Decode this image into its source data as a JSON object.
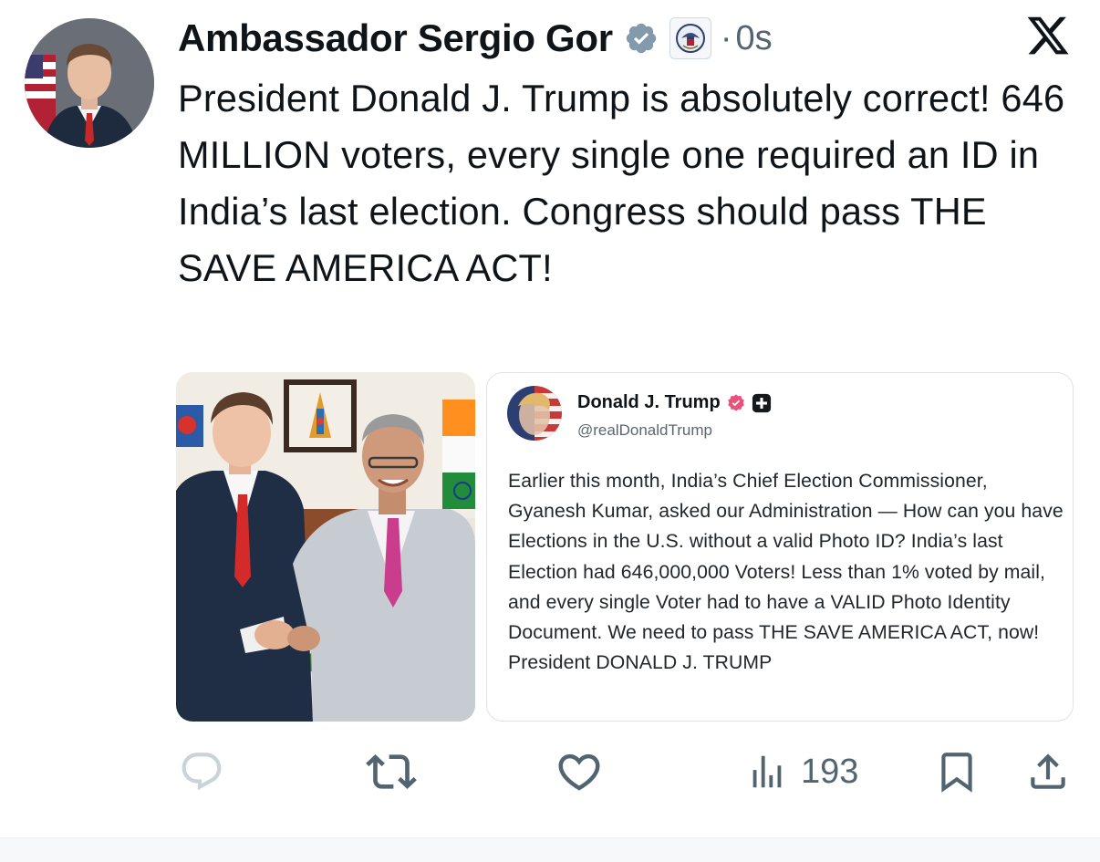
{
  "post": {
    "author_name": "Ambassador Sergio Gor",
    "time_separator": "·",
    "timestamp": "0s",
    "text": "President Donald J. Trump is absolutely correct! 646 MILLION voters, every single one required an ID in India’s last election. Congress should pass THE SAVE AMERICA ACT!"
  },
  "quoted_post": {
    "author_name": "Donald J. Trump",
    "handle": "@realDonaldTrump",
    "text": "Earlier this month, India’s Chief Election Commissioner, Gyanesh Kumar, asked our Administration — How can you have Elections in the U.S. without a valid Photo ID? India’s last Election had 646,000,000 Voters! Less than 1% voted by mail, and every single Voter had to have a VALID Photo Identity Document. We need to pass THE SAVE AMERICA ACT, now! President DONALD J. TRUMP"
  },
  "actions": {
    "views": "193"
  },
  "icons": {
    "verified": "verified-badge-icon",
    "affiliation": "state-department-seal-icon",
    "x_logo": "x-logo-icon",
    "reply": "reply-icon",
    "repost": "repost-icon",
    "like": "heart-icon",
    "views": "views-bar-chart-icon",
    "bookmark": "bookmark-icon",
    "share": "share-icon"
  },
  "colors": {
    "verified_blue_gray": "#829aab",
    "truth_social_badge": "#e9537b",
    "icon_gray": "#536471",
    "reply_icon_light": "#c9d3da"
  }
}
